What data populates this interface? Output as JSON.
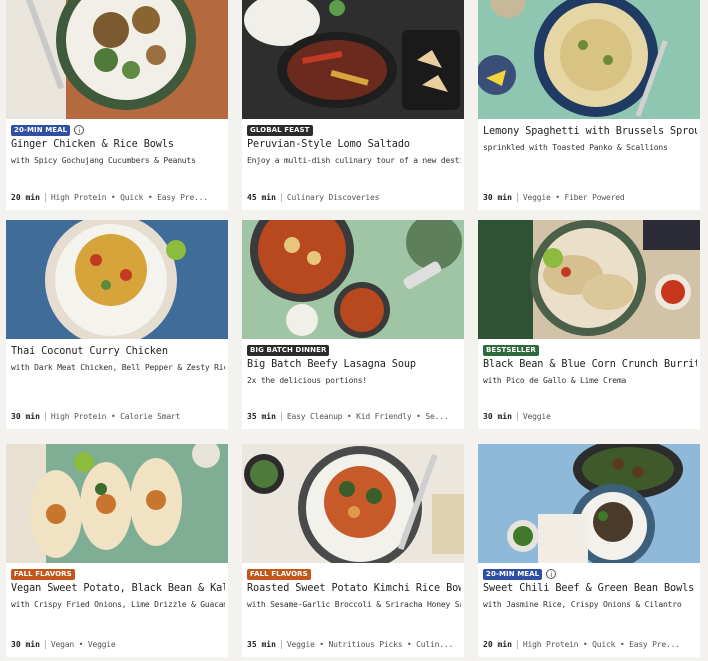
{
  "colors": {
    "badge_blue": "#2f4fa3",
    "badge_dark": "#2b2b2b",
    "badge_green": "#2f6a3c",
    "badge_orange": "#c2561b"
  },
  "cards": [
    {
      "badge": "20-MIN MEAL",
      "badge_color": "#2f4fa3",
      "info_icon": true,
      "title": "Ginger Chicken & Rice Bowls",
      "subtitle": "with Spicy Gochujang Cucumbers & Peanuts",
      "time": "20 min",
      "tags": "High Protein • Quick • Easy Pre..."
    },
    {
      "badge": "GLOBAL FEAST",
      "badge_color": "#2b2b2b",
      "info_icon": false,
      "title": "Peruvian-Style Lomo Saltado",
      "subtitle": "Enjoy a multi-dish culinary tour of a new destination!",
      "time": "45 min",
      "tags": "Culinary Discoveries"
    },
    {
      "badge": "",
      "badge_color": "",
      "info_icon": false,
      "title": "Lemony Spaghetti with Brussels Sprouts",
      "subtitle": "sprinkled with Toasted Panko & Scallions",
      "time": "30 min",
      "tags": "Veggie • Fiber Powered"
    },
    {
      "badge": "",
      "badge_color": "",
      "info_icon": false,
      "title": "Thai Coconut Curry Chicken",
      "subtitle": "with Dark Meat Chicken, Bell Pepper & Zesty Rice",
      "time": "30 min",
      "tags": "High Protein • Calorie Smart"
    },
    {
      "badge": "BIG BATCH DINNER",
      "badge_color": "#2b2b2b",
      "info_icon": false,
      "title": "Big Batch Beefy Lasagna Soup",
      "subtitle": "2x the delicious portions!",
      "time": "35 min",
      "tags": "Easy Cleanup • Kid Friendly • Se..."
    },
    {
      "badge": "BESTSELLER",
      "badge_color": "#2f6a3c",
      "info_icon": false,
      "title": "Black Bean & Blue Corn Crunch Burritos",
      "subtitle": "with Pico de Gallo & Lime Crema",
      "time": "30 min",
      "tags": "Veggie"
    },
    {
      "badge": "FALL FLAVORS",
      "badge_color": "#c2561b",
      "info_icon": false,
      "title": "Vegan Sweet Potato, Black Bean & Kale ...",
      "subtitle": "with Crispy Fried Onions, Lime Drizzle & Guacamole",
      "time": "30 min",
      "tags": "Vegan • Veggie"
    },
    {
      "badge": "FALL FLAVORS",
      "badge_color": "#c2561b",
      "info_icon": false,
      "title": "Roasted Sweet Potato Kimchi Rice Bowls",
      "subtitle": "with Sesame-Garlic Broccoli & Sriracha Honey Sauce",
      "time": "35 min",
      "tags": "Veggie • Nutritious Picks • Culin..."
    },
    {
      "badge": "20-MIN MEAL",
      "badge_color": "#2f4fa3",
      "info_icon": true,
      "title": "Sweet Chili Beef & Green Bean Bowls",
      "subtitle": "with Jasmine Rice, Crispy Onions & Cilantro",
      "time": "20 min",
      "tags": "High Protein • Quick • Easy Pre..."
    }
  ]
}
